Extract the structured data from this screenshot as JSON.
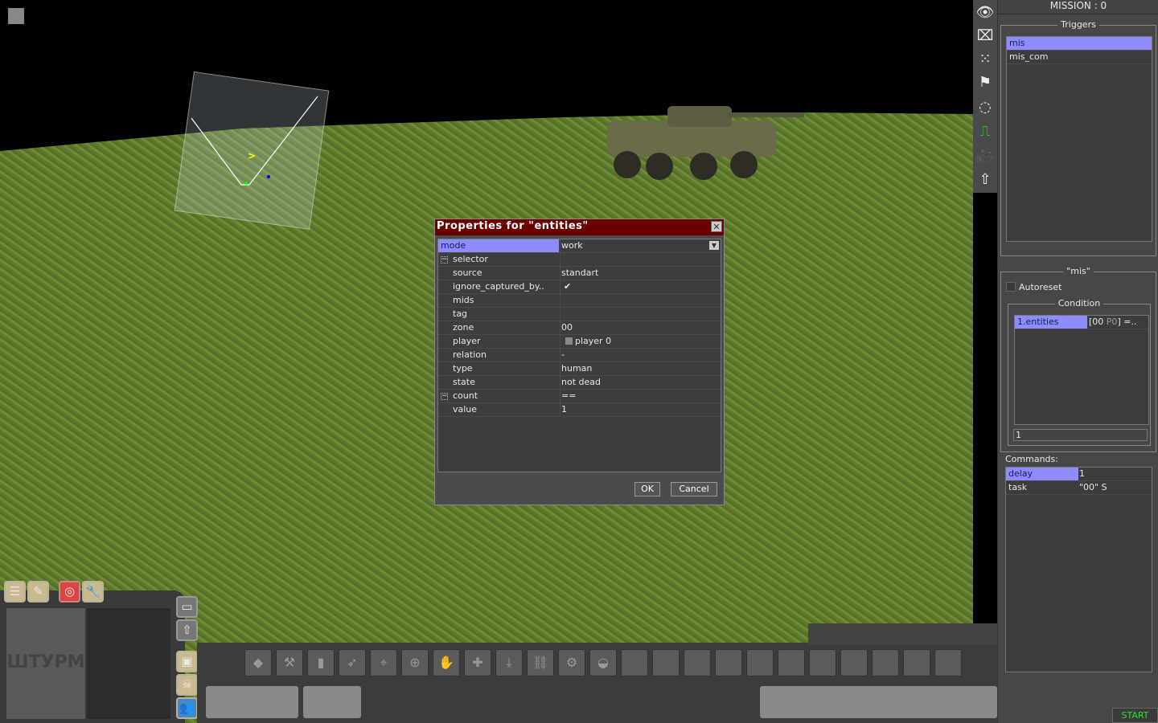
{
  "dialog": {
    "title": "Properties for \"entities\"",
    "close": "✕",
    "ok": "OK",
    "cancel": "Cancel",
    "rows": [
      {
        "key": "mode",
        "value": "work"
      },
      {
        "key": "selector",
        "value": ""
      },
      {
        "key": "source",
        "value": "standart"
      },
      {
        "key": "ignore_captured_by..",
        "value": "✔"
      },
      {
        "key": "mids",
        "value": ""
      },
      {
        "key": "tag",
        "value": ""
      },
      {
        "key": "zone",
        "value": "00"
      },
      {
        "key": "player",
        "value": "player 0"
      },
      {
        "key": "relation",
        "value": "-"
      },
      {
        "key": "type",
        "value": "human"
      },
      {
        "key": "state",
        "value": "not dead"
      },
      {
        "key": "count",
        "value": "=="
      },
      {
        "key": "value",
        "value": "1"
      }
    ]
  },
  "panel": {
    "title": "MISSION : 0",
    "triggers_label": "Triggers",
    "triggers": [
      "mis",
      "mis_com"
    ],
    "trigger_group": "\"mis\"",
    "autoreset": "Autoreset",
    "condition_label": "Condition",
    "condition": {
      "name": "1.entities",
      "value_a": "[00 ",
      "value_b": "P0",
      "value_c": "] =.."
    },
    "condition_input": "1",
    "commands_label": "Commands:",
    "commands": [
      {
        "key": "delay",
        "value": "1"
      },
      {
        "key": "task",
        "value": "\"00\" S"
      }
    ],
    "start": "START"
  },
  "toolbar": [
    "eye-icon",
    "eraser-icon",
    "grid-select-icon",
    "flag-icon",
    "circle-zone-icon",
    "trigger-icon",
    "camera-icon",
    "arrow-up-icon"
  ],
  "hud": {
    "logo": "ШТУРМ"
  },
  "colors": {
    "selection": "#8c8cff",
    "title_bar": "#6b0000",
    "start": "#33dd33"
  }
}
